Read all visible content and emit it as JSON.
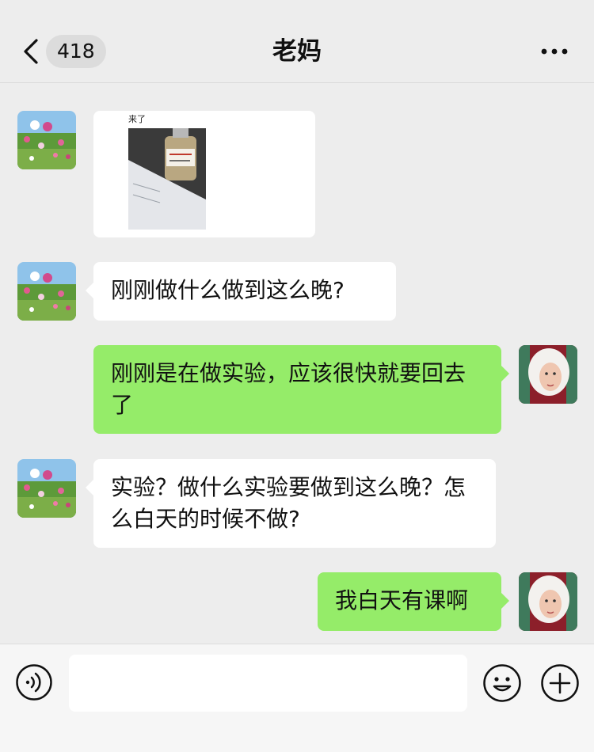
{
  "header": {
    "unread_count": "418",
    "title": "老妈"
  },
  "messages": [
    {
      "sender": "mom",
      "type": "image",
      "caption": "来了"
    },
    {
      "sender": "mom",
      "type": "text",
      "text": "刚刚做什么做到这么晚?"
    },
    {
      "sender": "me",
      "type": "text",
      "text": "刚刚是在做实验，应该很快就要回去了"
    },
    {
      "sender": "mom",
      "type": "text",
      "text": "实验？做什么实验要做到这么晚？怎么白天的时候不做?"
    },
    {
      "sender": "me",
      "type": "text",
      "text": "我白天有课啊"
    }
  ],
  "input_bar": {
    "text_value": "",
    "icons": [
      "voice-icon",
      "emoji-icon",
      "add-icon"
    ]
  },
  "colors": {
    "background": "#ededed",
    "bubble_mine": "#95ec69",
    "bubble_theirs": "#ffffff"
  }
}
